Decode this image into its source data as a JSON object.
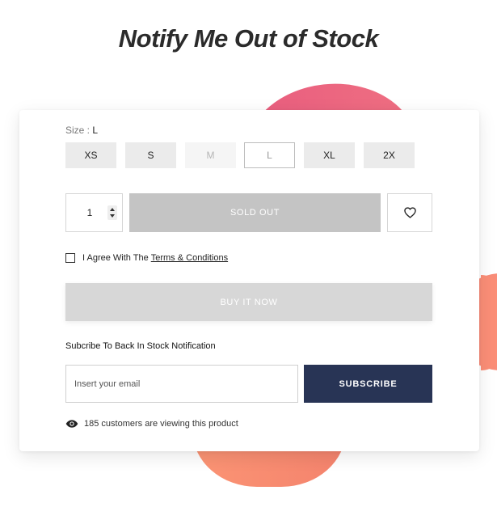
{
  "page": {
    "title": "Notify Me Out of Stock"
  },
  "colors": {
    "accent_pink": "#e85c7e",
    "accent_coral": "#f98d79",
    "subscribe_bg": "#283455",
    "sold_out_bg": "#c4c4c4",
    "buy_now_bg": "#d7d7d7"
  },
  "size": {
    "label": "Size :",
    "selected": "L",
    "options": [
      {
        "label": "XS",
        "state": "available"
      },
      {
        "label": "S",
        "state": "available"
      },
      {
        "label": "M",
        "state": "unavailable"
      },
      {
        "label": "L",
        "state": "selected"
      },
      {
        "label": "XL",
        "state": "available"
      },
      {
        "label": "2X",
        "state": "available"
      }
    ]
  },
  "cart": {
    "quantity": "1",
    "sold_out_label": "SOLD OUT",
    "wishlist_icon": "heart-icon"
  },
  "terms": {
    "prefix": "I Agree With The",
    "link": "Terms & Conditions",
    "checked": false
  },
  "buy_now": {
    "label": "BUY IT NOW"
  },
  "notify": {
    "heading": "Subcribe To Back In Stock Notification",
    "email_placeholder": "Insert your email",
    "subscribe_label": "SUBSCRIBE"
  },
  "viewers": {
    "icon": "eye-icon",
    "text": "185 customers are viewing this product"
  }
}
